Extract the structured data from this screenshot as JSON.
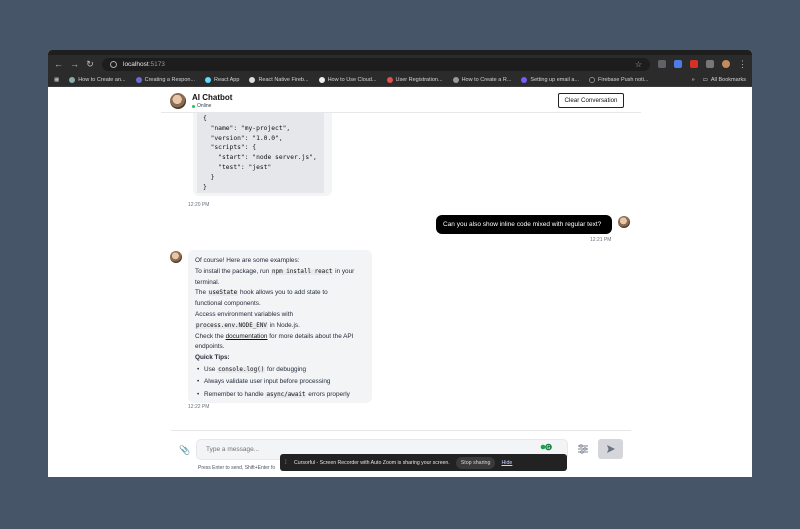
{
  "browser": {
    "url_host": "localhost",
    "url_port": ":5173",
    "bookmarks": [
      "How to Create an...",
      "Creating a Respon...",
      "React App",
      "React Native Fireb...",
      "How to Use Cloud...",
      "User Registration...",
      "How to Create a R...",
      "Setting up email a...",
      "Firebase Push noti..."
    ],
    "all_bookmarks": "All Bookmarks"
  },
  "header": {
    "title": "AI Chatbot",
    "status": "Online",
    "clear_button": "Clear Conversation"
  },
  "messages": {
    "code_lines": [
      "{",
      "  \"name\": \"my-project\",",
      "  \"version\": \"1.0.0\",",
      "  \"scripts\": {",
      "    \"start\": \"node server.js\",",
      "    \"test\": \"jest\"",
      "  }",
      "}"
    ],
    "code_time": "12:20 PM",
    "user_text": "Can you also show inline code mixed with regular text?",
    "user_time": "12:21 PM",
    "bot": {
      "l1": "Of course! Here are some examples:",
      "l2a": "To install the package, run ",
      "l2code": "npm install react",
      "l2b": " in your",
      "l3": "terminal.",
      "l4a": "The ",
      "l4code": "useState",
      "l4b": " hook allows you to add state to",
      "l5": "functional components.",
      "l6": "Access environment variables with",
      "l7code": "process.env.NODE_ENV",
      "l7b": " in Node.js.",
      "l8a": "Check the ",
      "l8link": "documentation",
      "l8b": " for more details about the API",
      "l9": "endpoints.",
      "tips_title": "Quick Tips:",
      "tip1a": "Use ",
      "tip1code": "console.log()",
      "tip1b": " for debugging",
      "tip2": "Always validate user input before processing",
      "tip3a": "Remember to handle ",
      "tip3code": "async/await",
      "tip3b": " errors properly"
    },
    "bot_time": "12:22 PM"
  },
  "composer": {
    "placeholder": "Type a message...",
    "hint": "Press Enter to send, Shift+Enter fo"
  },
  "share_bar": {
    "text": "Cursorful - Screen Recorder with Auto Zoom is sharing your screen.",
    "stop": "Stop sharing",
    "hide": "Hide"
  },
  "colors": {
    "page_bg": "#475569",
    "online": "#22c55e",
    "user_bubble": "#000000",
    "bot_bubble": "#f3f4f6"
  }
}
